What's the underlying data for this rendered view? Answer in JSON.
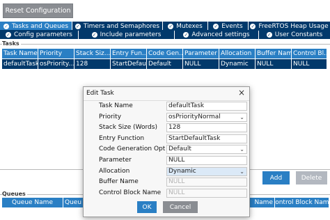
{
  "toolbar": {
    "reset_label": "Reset Configuration"
  },
  "tabs_row1": [
    {
      "label": "Tasks and Queues",
      "active": true
    },
    {
      "label": "Timers and Semaphores",
      "active": false
    },
    {
      "label": "Mutexes",
      "active": false
    },
    {
      "label": "Events",
      "active": false
    },
    {
      "label": "FreeRTOS Heap Usage",
      "active": false
    }
  ],
  "tabs_row2": [
    {
      "label": "Config parameters"
    },
    {
      "label": "Include parameters"
    },
    {
      "label": "Advanced settings"
    },
    {
      "label": "User Constants"
    }
  ],
  "tasks": {
    "section_label": "Tasks",
    "headers": [
      "Task Name",
      "Priority",
      "Stack Siz...",
      "Entry Fun...",
      "Code Gen...",
      "Parameter",
      "Allocation",
      "Buffer Name",
      "Control Bl..."
    ],
    "row": [
      "defaultTask",
      "osPriority...",
      "128",
      "StartDefau...",
      "Default",
      "NULL",
      "Dynamic",
      "NULL",
      "NULL"
    ]
  },
  "side_buttons": {
    "add_label": "Add",
    "delete_label": "Delete"
  },
  "queues": {
    "section_label": "Queues",
    "headers_left": [
      "Queue Name",
      "Queu"
    ],
    "headers_right": [
      "Name",
      "Control Block Name"
    ]
  },
  "dialog": {
    "title": "Edit Task",
    "close_glyph": "×",
    "fields": [
      {
        "label": "Task Name",
        "value": "defaultTask",
        "dropdown": false,
        "disabled": false
      },
      {
        "label": "Priority",
        "value": "osPriorityNormal",
        "dropdown": true,
        "disabled": false
      },
      {
        "label": "Stack Size (Words)",
        "value": "128",
        "dropdown": false,
        "disabled": false
      },
      {
        "label": "Entry Function",
        "value": "StartDefaultTask",
        "dropdown": false,
        "disabled": false
      },
      {
        "label": "Code Generation Option",
        "value": "Default",
        "dropdown": true,
        "disabled": false
      },
      {
        "label": "Parameter",
        "value": "NULL",
        "dropdown": false,
        "disabled": false
      },
      {
        "label": "Allocation",
        "value": "Dynamic",
        "dropdown": true,
        "disabled": false,
        "selected": true
      },
      {
        "label": "Buffer Name",
        "value": "NULL",
        "dropdown": false,
        "disabled": true
      },
      {
        "label": "Control Block Name",
        "value": "NULL",
        "dropdown": false,
        "disabled": true
      }
    ],
    "ok_label": "OK",
    "cancel_label": "Cancel"
  },
  "colors": {
    "tab_dark": "#02396b",
    "tab_active": "#2a7fc4",
    "button_gray": "#8a8d92",
    "delete_disabled": "#b3b8c0"
  },
  "icons": {
    "tab_status": "check-circle-icon",
    "dropdown": "chevron-down-icon",
    "close": "close-icon"
  }
}
